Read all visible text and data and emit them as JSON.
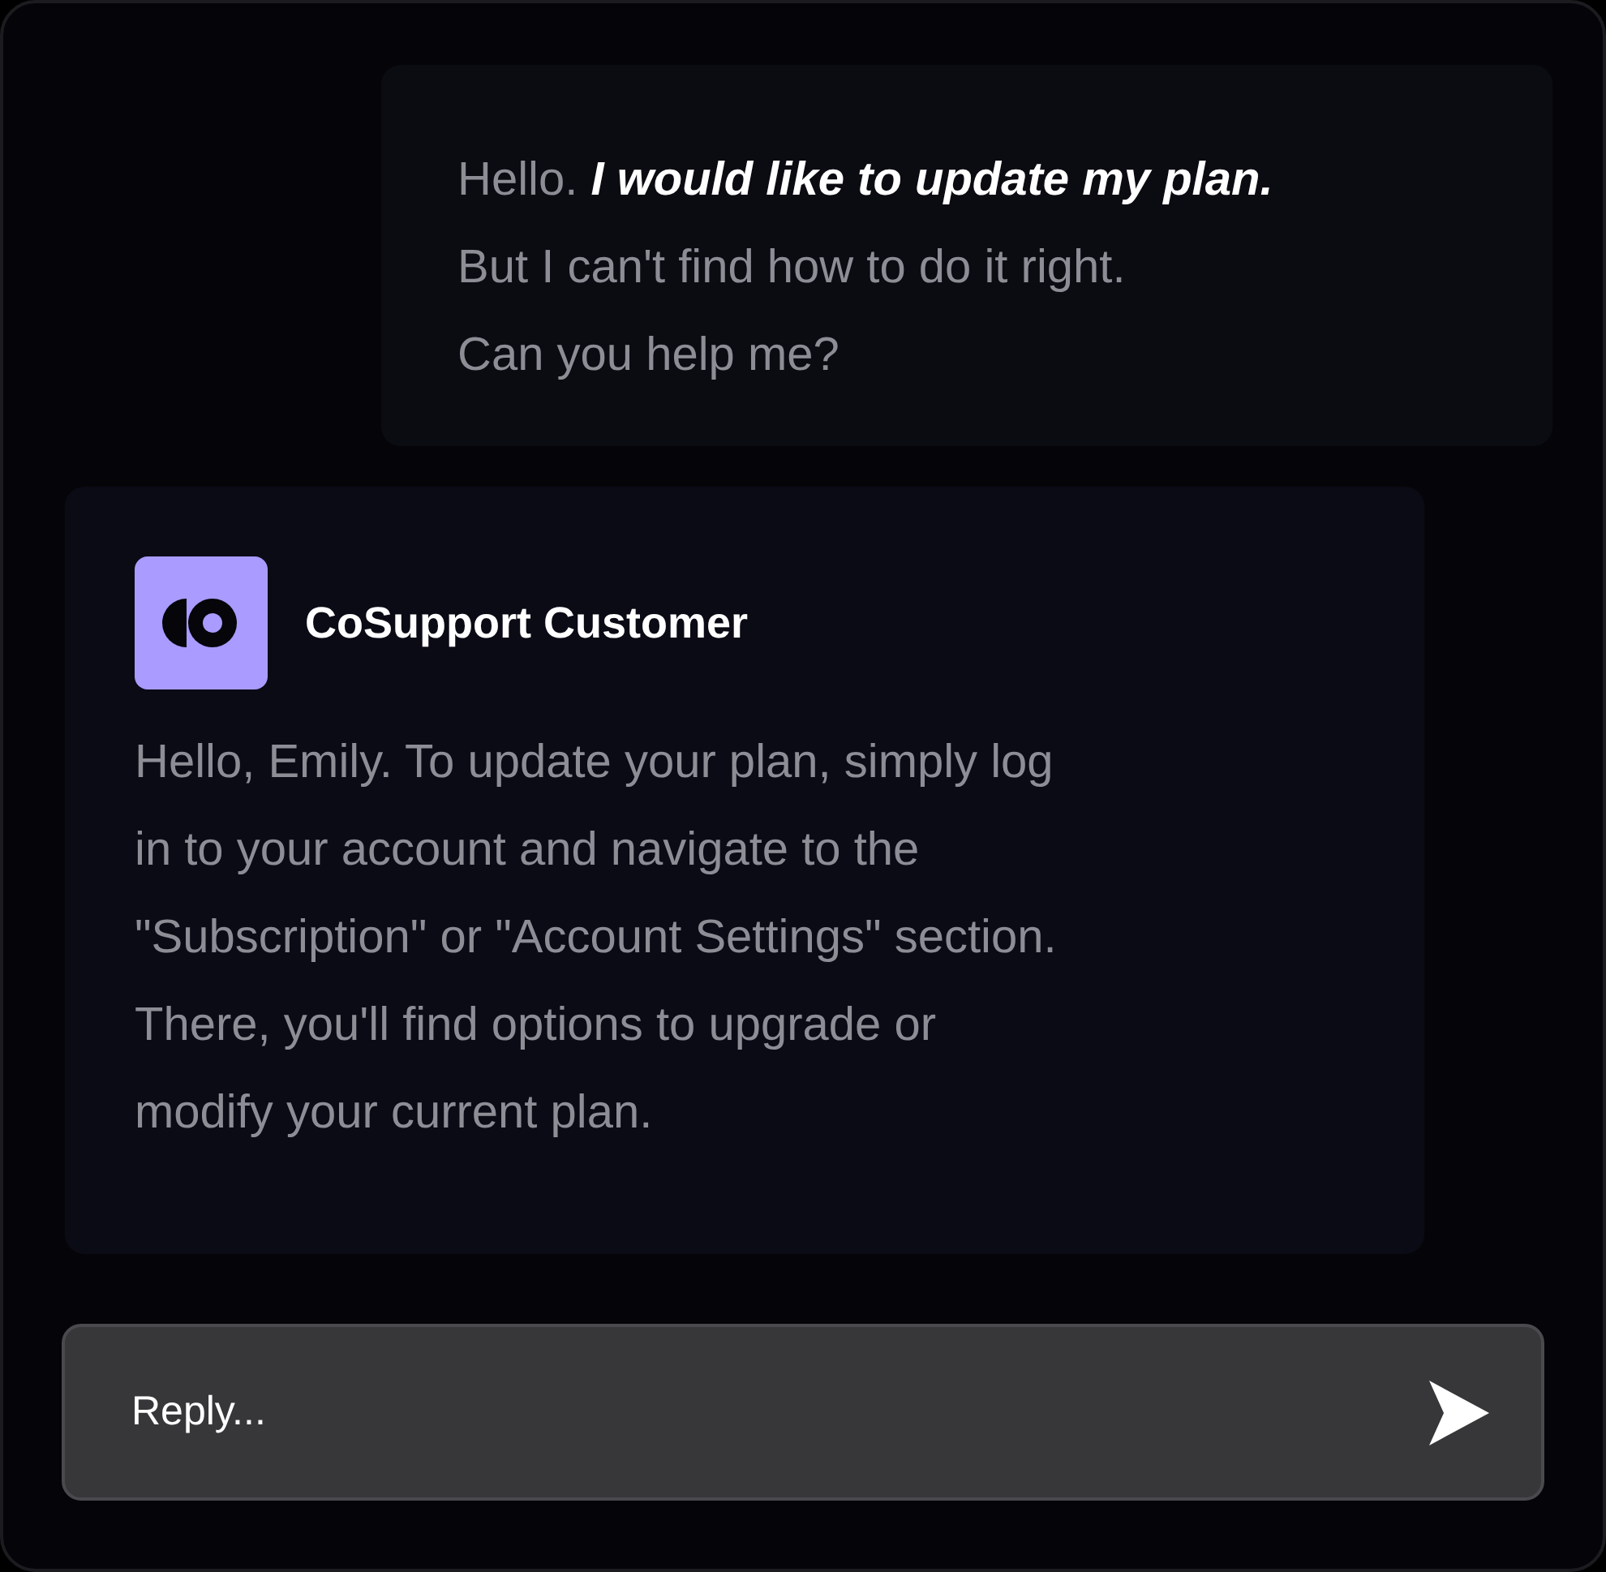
{
  "user_message": {
    "lines": [
      "Hello. **I would like to update my plan.**",
      "But I can't find how to do it right.",
      "Can you help me?"
    ]
  },
  "agent_message": {
    "sender": "CoSupport Customer",
    "lines": [
      "Hello, Emily. To update your plan, simply log",
      "in to your account and navigate to the",
      "\"Subscription\" or \"Account Settings\" section.",
      "There, you'll find options to upgrade or",
      "modify your current plan."
    ]
  },
  "reply_box": {
    "placeholder": "Reply..."
  }
}
